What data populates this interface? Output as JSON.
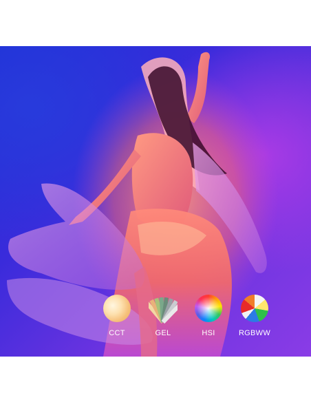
{
  "photo": {
    "subject": "dancer-in-flowing-fabric",
    "colors": {
      "background_blue": "#1d2fd6",
      "background_violet": "#8a3ce6",
      "fabric_warm": "#ff7a5c",
      "fabric_pink": "#e46ad6"
    }
  },
  "modes": [
    {
      "label": "CCT",
      "icon": "cct-warm-white-disc-icon"
    },
    {
      "label": "GEL",
      "icon": "gel-swatch-fan-icon"
    },
    {
      "label": "HSI",
      "icon": "hsi-color-wheel-icon"
    },
    {
      "label": "RGBWW",
      "icon": "rgbww-color-wheel-icon"
    }
  ]
}
